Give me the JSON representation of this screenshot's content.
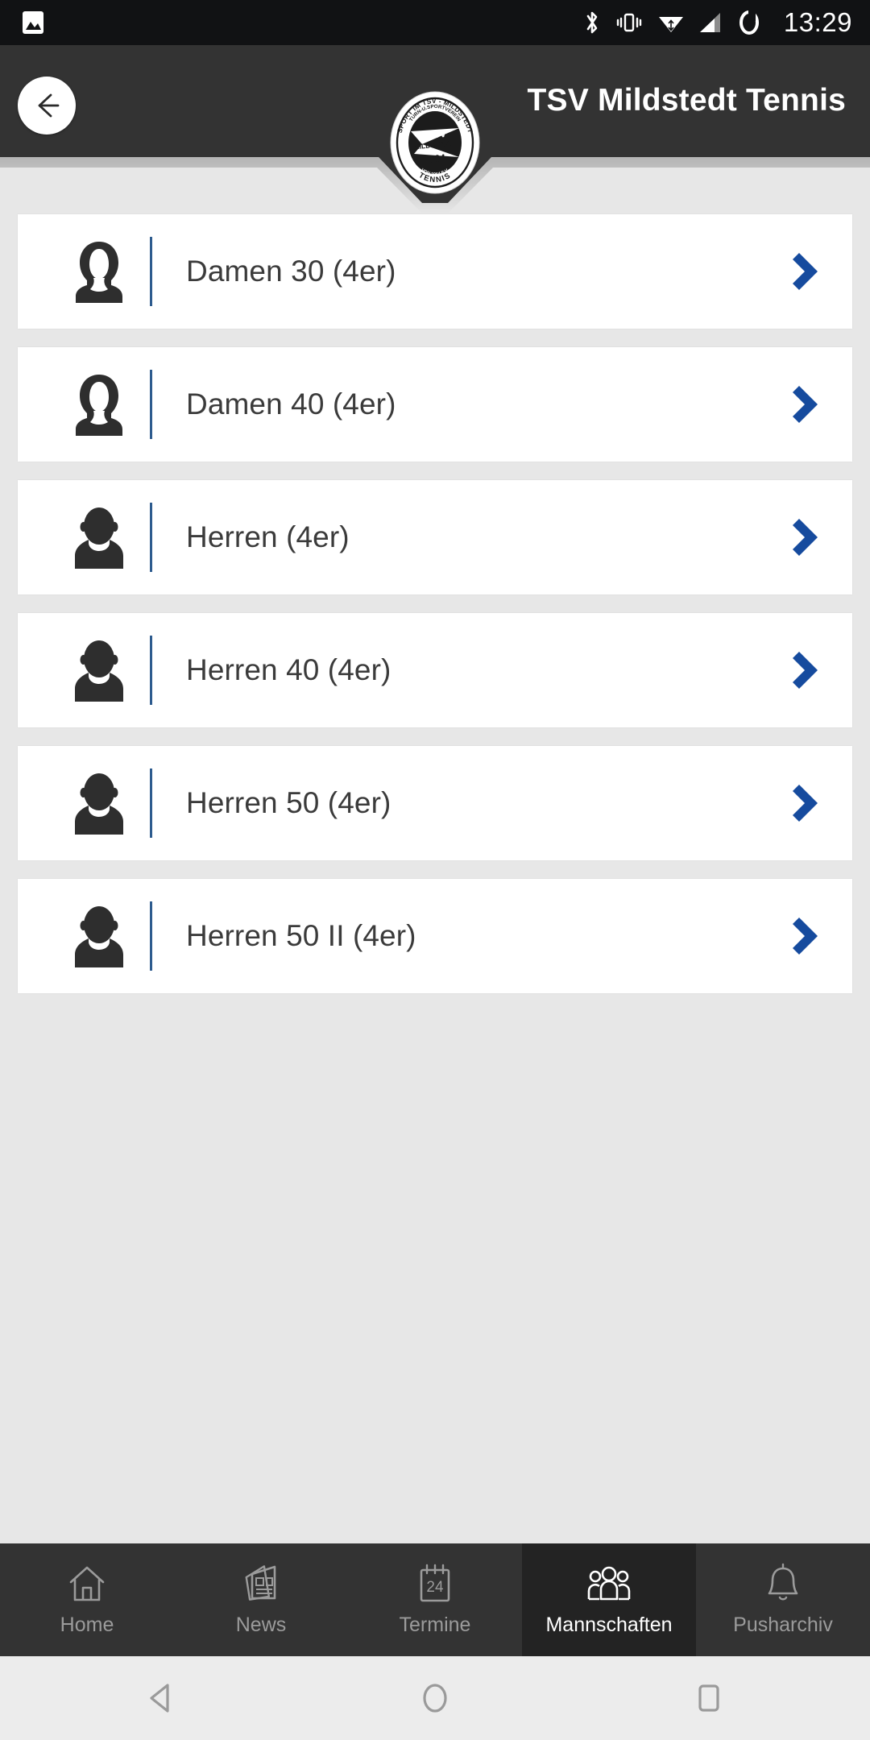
{
  "statusbar": {
    "time": "13:29",
    "icons": [
      "image-icon",
      "bluetooth-icon",
      "vibrate-icon",
      "wifi-icon",
      "cellular-signal-icon",
      "battery-icon"
    ]
  },
  "header": {
    "title": "TSV Mildstedt Tennis",
    "back_icon": "back-arrow-icon",
    "bg_color": "#333333",
    "logo": {
      "name": "tsv-mildstedt-club-logo",
      "outer_top_text": "SPORT IM TSV - MILDSTEDT",
      "inner_arc_text": "TURN-U.SPORTVEREIN",
      "center_top": "TSV",
      "center_mid": "MILDSTEDT",
      "center_year": "1964",
      "sub_text": "VON 1964 E.V.",
      "bottom_text": "TENNIS"
    }
  },
  "theme": {
    "accent_blue": "#164b9e",
    "rule_blue": "#2d5b8e",
    "page_bg": "#e7e7e7",
    "card_bg": "#ffffff",
    "text_dark": "#3b3b3b"
  },
  "teams": [
    {
      "label": "Damen 30 (4er)",
      "avatar": "female-avatar-icon",
      "chevron": "chevron-right-icon"
    },
    {
      "label": "Damen 40 (4er)",
      "avatar": "female-avatar-icon",
      "chevron": "chevron-right-icon"
    },
    {
      "label": "Herren (4er)",
      "avatar": "male-avatar-icon",
      "chevron": "chevron-right-icon"
    },
    {
      "label": "Herren 40 (4er)",
      "avatar": "male-avatar-icon",
      "chevron": "chevron-right-icon"
    },
    {
      "label": "Herren 50 (4er)",
      "avatar": "male-avatar-icon",
      "chevron": "chevron-right-icon"
    },
    {
      "label": "Herren 50 II (4er)",
      "avatar": "male-avatar-icon",
      "chevron": "chevron-right-icon"
    }
  ],
  "tabbar": [
    {
      "label": "Home",
      "icon": "home-icon",
      "active": false
    },
    {
      "label": "News",
      "icon": "news-icon",
      "active": false
    },
    {
      "label": "Termine",
      "icon": "calendar-icon",
      "active": false,
      "calendar_day": "24"
    },
    {
      "label": "Mannschaften",
      "icon": "group-icon",
      "active": true
    },
    {
      "label": "Pusharchiv",
      "icon": "bell-icon",
      "active": false
    }
  ],
  "androidnav": {
    "back": "nav-back-triangle-icon",
    "home": "nav-home-circle-icon",
    "recents": "nav-recents-square-icon"
  }
}
